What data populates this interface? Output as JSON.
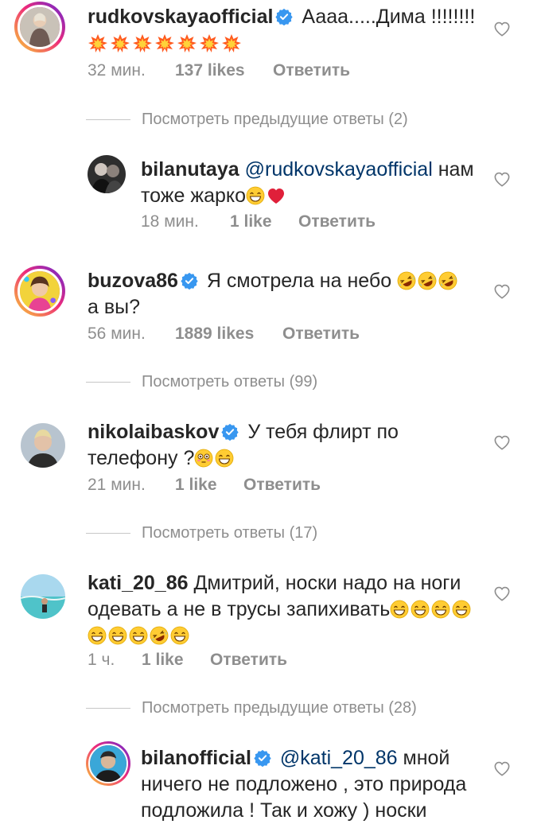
{
  "comments": [
    {
      "username": "rudkovskayaofficial",
      "text": "Аааа.....Дима !!!!!!!!",
      "time": "32 мин.",
      "likes": "137 likes",
      "reply": "Ответить",
      "emojis": "💥💥💥💥💥💥💥"
    },
    {
      "username": "bilanutaya",
      "mention": "@rudkovskayaofficial",
      "text": " нам тоже жарко",
      "time": "18 мин.",
      "likes": "1 like",
      "reply": "Ответить"
    },
    {
      "username": "buzova86",
      "text": "Я смотрела на небо ",
      "text2": "а вы?",
      "time": "56 мин.",
      "likes": "1889 likes",
      "reply": "Ответить"
    },
    {
      "username": "nikolaibaskov",
      "text": "У тебя флирт по телефону ?",
      "time": "21 мин.",
      "likes": "1 like",
      "reply": "Ответить"
    },
    {
      "username": "kati_20_86",
      "text": "Дмитрий, носки надо на ноги одевать а не в трусы запихивать",
      "time": "1 ч.",
      "likes": "1 like",
      "reply": "Ответить"
    },
    {
      "username": "bilanofficial",
      "mention": "@kati_20_86",
      "text": " мной ничего не подложено , это природа подложила ! Так и хожу ) носки"
    }
  ],
  "reply_links": [
    "Посмотреть предыдущие ответы (2)",
    "Посмотреть ответы (99)",
    "Посмотреть ответы (17)",
    "Посмотреть предыдущие ответы (28)"
  ],
  "colors": {
    "text": "#262626",
    "meta": "#8e8e8e",
    "mention": "#003569",
    "verified": "#3897f0"
  }
}
